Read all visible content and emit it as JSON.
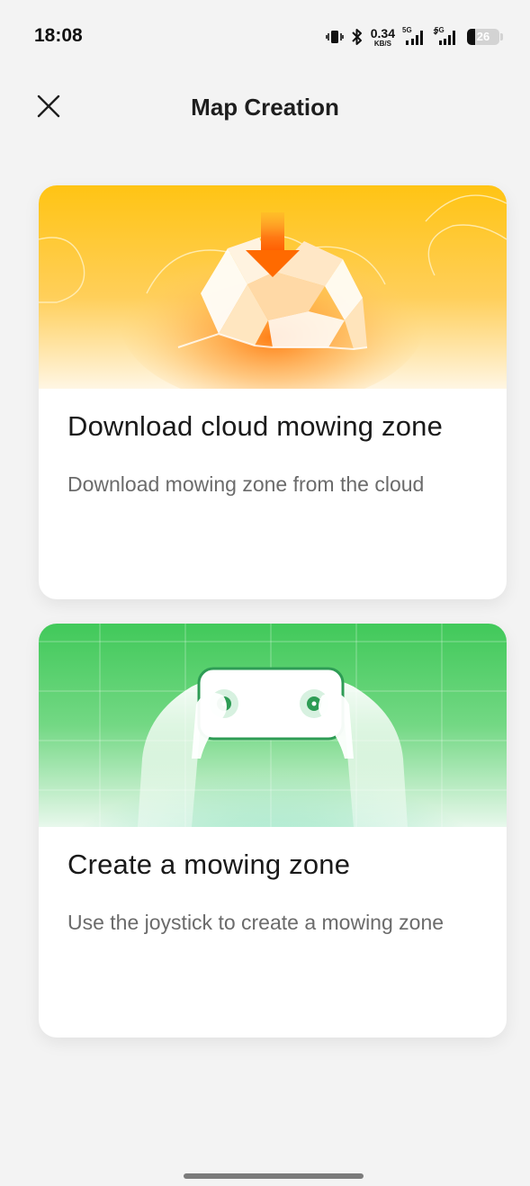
{
  "status_bar": {
    "time": "18:08",
    "speed_value": "0.34",
    "speed_unit": "KB/S",
    "network_1": "5G",
    "network_2": "5G",
    "battery_level": "26",
    "battery_fraction": 0.26
  },
  "header": {
    "title": "Map Creation",
    "close_icon": "close-icon"
  },
  "cards": [
    {
      "title": "Download cloud mowing zone",
      "description": "Download mowing zone from the cloud",
      "illustration": "cloud-map-download-illustration",
      "accent": "#ff8a1e"
    },
    {
      "title": "Create a mowing zone",
      "description": "Use the joystick to create a mowing zone",
      "illustration": "joystick-controller-illustration",
      "accent": "#3fbf62"
    }
  ]
}
